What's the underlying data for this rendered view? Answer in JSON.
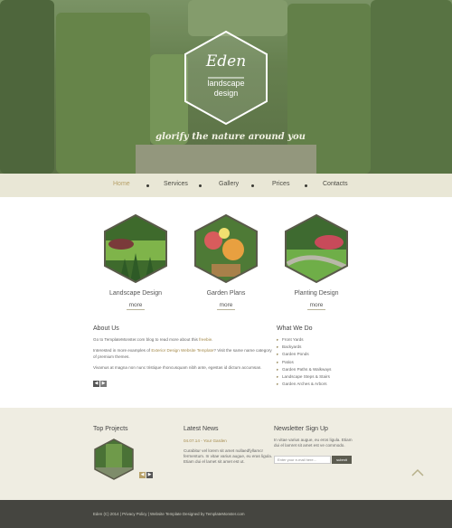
{
  "logo": {
    "title": "Eden",
    "subtitle_line1": "landscape",
    "subtitle_line2": "design",
    "tagline": "glorify the nature around you"
  },
  "nav": {
    "items": [
      "Home",
      "Services",
      "Gallery",
      "Prices",
      "Contacts"
    ],
    "active": "Home",
    "accent_color": "#b7a169"
  },
  "features": [
    {
      "title": "Landscape Design",
      "more": "more"
    },
    {
      "title": "Garden Plans",
      "more": "more"
    },
    {
      "title": "Planting Design",
      "more": "more"
    }
  ],
  "about": {
    "title": "About Us",
    "line1_prefix": "Go to TemplateMonster.com blog to read more about this ",
    "line1_link": "freebie",
    "line1_suffix": ".",
    "line2_prefix": "Interested in more examples of ",
    "line2_link": "Exterior Design Website Template",
    "line2_suffix": "? Visit the same name category of premium themes.",
    "line3": "Vivamus at magna non nunc tristique rhoncusquam nibh ante, egestas id dictum accumsan."
  },
  "what_we_do": {
    "title": "What We Do",
    "items": [
      "Front Yards",
      "Backyards",
      "Garden Ponds",
      "Patios",
      "Garden Paths & Walkways",
      "Landscape Steps & Stairs",
      "Garden Arches & Arbors"
    ]
  },
  "pager": {
    "prev": "◀",
    "next": "▶"
  },
  "top_projects": {
    "title": "Top Projects"
  },
  "latest_news": {
    "title": "Latest News",
    "date": "04.07.14 - Your Garden",
    "text": "Curabitur vel lorem sit amet nullaedfyllamcr fermentum. In vitae varius augue, eu eras ligula. Etiam dui el lamet sit amet est ut."
  },
  "newsletter": {
    "title": "Newsletter Sign Up",
    "text": "In vitae varius augue, eu eros ligula. Etiam dui el lamret sit amet est ve commodo.",
    "placeholder": "Enter your e-mail here...",
    "button": "submit"
  },
  "footer": {
    "text": "Eden (C) 2014  |  Privacy Policy  |  Website Template Designed by TemplateMonster.com"
  }
}
